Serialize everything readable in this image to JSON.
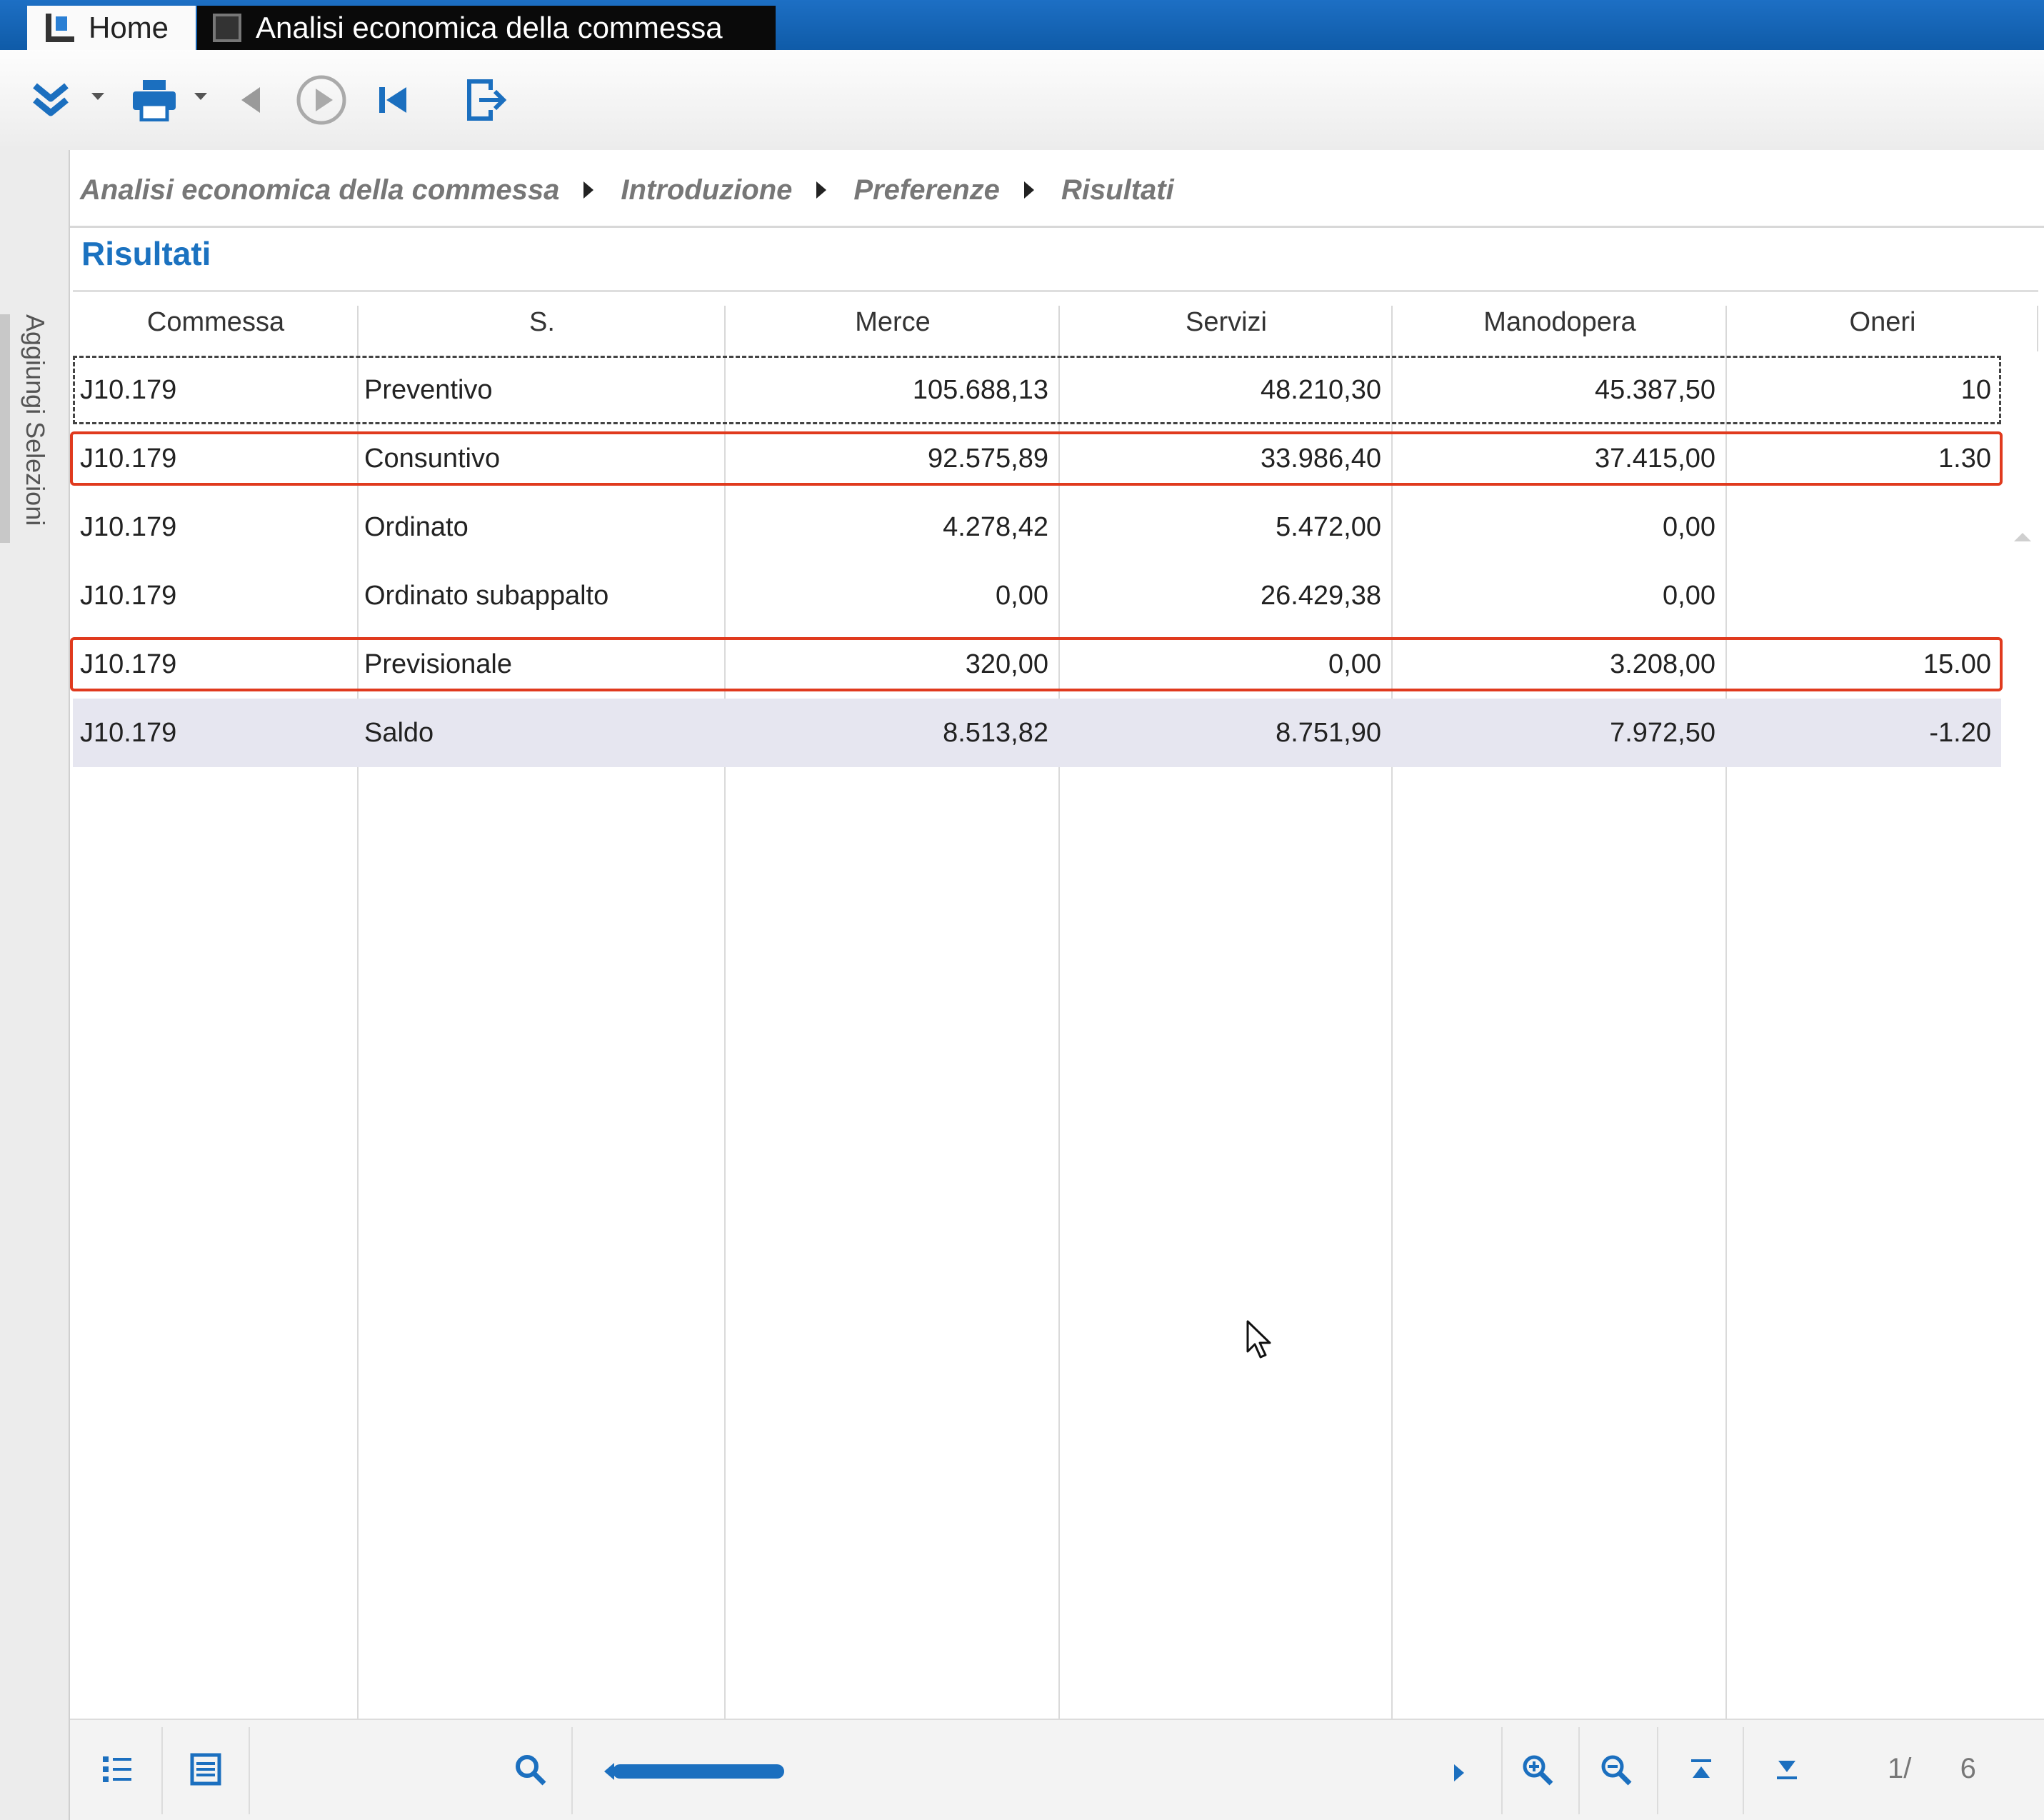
{
  "tabs": {
    "home": "Home",
    "active": "Analisi economica della commessa"
  },
  "sidepanel": {
    "label": "Aggiungi Selezioni"
  },
  "breadcrumb": [
    "Analisi economica della commessa",
    "Introduzione",
    "Preferenze",
    "Risultati"
  ],
  "section_title": "Risultati",
  "grid": {
    "columns": [
      "Commessa",
      "S.",
      "Merce",
      "Servizi",
      "Manodopera",
      "Oneri"
    ],
    "rows": [
      {
        "commessa": "J10.179",
        "s": "Preventivo",
        "merce": "105.688,13",
        "servizi": "48.210,30",
        "manodopera": "45.387,50",
        "oneri": "10"
      },
      {
        "commessa": "J10.179",
        "s": "Consuntivo",
        "merce": "92.575,89",
        "servizi": "33.986,40",
        "manodopera": "37.415,00",
        "oneri": "1.30"
      },
      {
        "commessa": "J10.179",
        "s": "Ordinato",
        "merce": "4.278,42",
        "servizi": "5.472,00",
        "manodopera": "0,00",
        "oneri": ""
      },
      {
        "commessa": "J10.179",
        "s": "Ordinato subappalto",
        "merce": "0,00",
        "servizi": "26.429,38",
        "manodopera": "0,00",
        "oneri": ""
      },
      {
        "commessa": "J10.179",
        "s": "Previsionale",
        "merce": "320,00",
        "servizi": "0,00",
        "manodopera": "3.208,00",
        "oneri": "15.00"
      },
      {
        "commessa": "J10.179",
        "s": "Saldo",
        "merce": "8.513,82",
        "servizi": "8.751,90",
        "manodopera": "7.972,50",
        "oneri": "-1.20"
      }
    ]
  },
  "pager": {
    "current": "1/",
    "total": "6"
  },
  "colors": {
    "accent": "#1b6fbf",
    "highlight": "#e03a1e",
    "title": "#1b72c0"
  },
  "icons": {
    "toolbar": [
      "expand-all-icon",
      "print-icon",
      "back-icon",
      "run-icon",
      "first-icon",
      "exit-icon"
    ],
    "bottom": [
      "tree-list-icon",
      "detail-list-icon",
      "search-icon",
      "zoom-in-icon",
      "zoom-out-icon",
      "go-top-icon",
      "go-bottom-icon"
    ]
  }
}
